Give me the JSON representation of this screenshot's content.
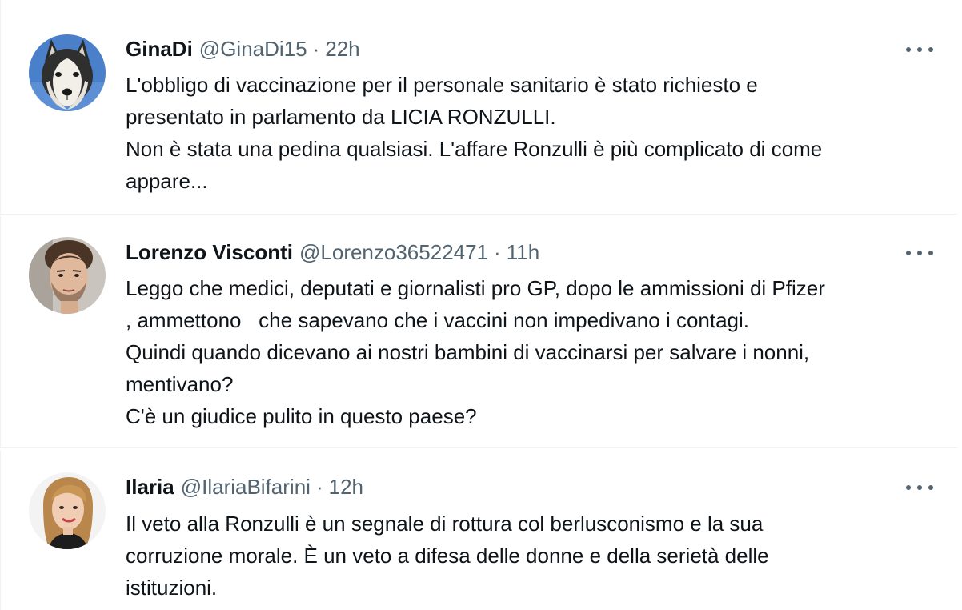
{
  "tweets": [
    {
      "name": "GinaDi",
      "handle": "@GinaDi15",
      "dot": "·",
      "time": "22h",
      "avatar_icon": "husky-dog-avatar",
      "lines": [
        "L'obbligo di vaccinazione per il personale sanitario è stato richiesto e",
        "presentato in parlamento da LICIA RONZULLI.",
        "Non è stata una pedina qualsiasi. L'affare Ronzulli è più complicato di come",
        "appare..."
      ]
    },
    {
      "name": "Lorenzo Visconti",
      "handle": "@Lorenzo36522471",
      "dot": "·",
      "time": "11h",
      "avatar_icon": "man-portrait-avatar",
      "lines": [
        "Leggo che medici, deputati e giornalisti pro GP, dopo le ammissioni di Pfizer",
        ", ammettono   che sapevano che i vaccini non impedivano i contagi.",
        "Quindi quando dicevano ai nostri bambini di vaccinarsi per salvare i nonni,",
        "mentivano?",
        "C'è un giudice pulito in questo paese?"
      ]
    },
    {
      "name": "Ilaria",
      "handle": "@IlariaBifarini",
      "dot": "·",
      "time": "12h",
      "avatar_icon": "woman-portrait-avatar",
      "lines": [
        "Il veto alla Ronzulli è un segnale di rottura col berlusconismo e la sua",
        "corruzione morale. È un veto a difesa delle donne e della serietà delle",
        "istituzioni."
      ]
    }
  ],
  "colors": {
    "text": "#0f1419",
    "secondary": "#536471",
    "divider": "#eff3f4"
  }
}
